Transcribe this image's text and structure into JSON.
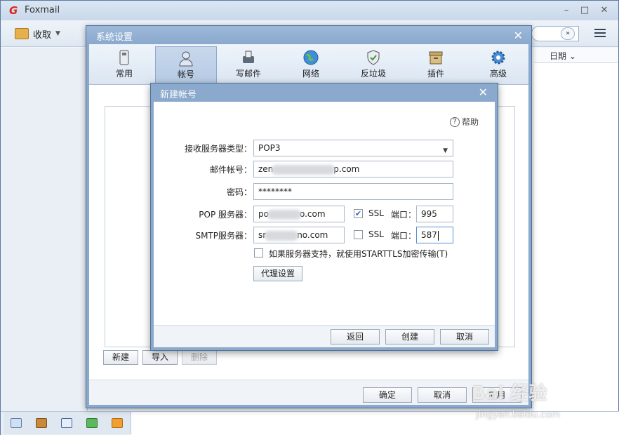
{
  "app": {
    "title": "Foxmail",
    "logo": "G"
  },
  "toolbar": {
    "receive_label": "收取"
  },
  "mail_list": {
    "date_column": "日期"
  },
  "system_settings": {
    "title": "系统设置",
    "tabs": [
      {
        "label": "常用"
      },
      {
        "label": "帐号"
      },
      {
        "label": "写邮件"
      },
      {
        "label": "网络"
      },
      {
        "label": "反垃圾"
      },
      {
        "label": "插件"
      },
      {
        "label": "高级"
      }
    ],
    "active_tab": "帐号",
    "account_buttons": {
      "new": "新建",
      "import": "导入",
      "delete": "删除"
    },
    "footer": {
      "ok": "确定",
      "cancel": "取消",
      "apply": "应用"
    }
  },
  "new_account": {
    "title": "新建帐号",
    "help": "帮助",
    "server_type_label": "接收服务器类型：",
    "server_type_value": "POP3",
    "email_label": "邮件帐号：",
    "email_prefix": "zen",
    "email_suffix": "p.com",
    "password_label": "密码：",
    "password_value": "********",
    "pop_label": "POP 服务器：",
    "pop_prefix": "po",
    "pop_suffix": "o.com",
    "pop_ssl_label": "SSL",
    "pop_ssl_checked": true,
    "pop_port_label": "端口：",
    "pop_port": "995",
    "smtp_label": "SMTP服务器：",
    "smtp_prefix": "sr",
    "smtp_suffix": "no.com",
    "smtp_ssl_label": "SSL",
    "smtp_ssl_checked": false,
    "smtp_port_label": "端口：",
    "smtp_port": "587",
    "starttls_label": "如果服务器支持，就使用STARTTLS加密传输(T)",
    "proxy_button": "代理设置",
    "back_button": "返回",
    "create_button": "创建",
    "cancel_button": "取消"
  },
  "watermark": {
    "text": "Bai 经验",
    "sub": "jingyan.baidu.com"
  },
  "colors": {
    "dialog_frame": "#8aa9cc",
    "accent_blue": "#2a62b8",
    "logo_red": "#d9251b"
  }
}
